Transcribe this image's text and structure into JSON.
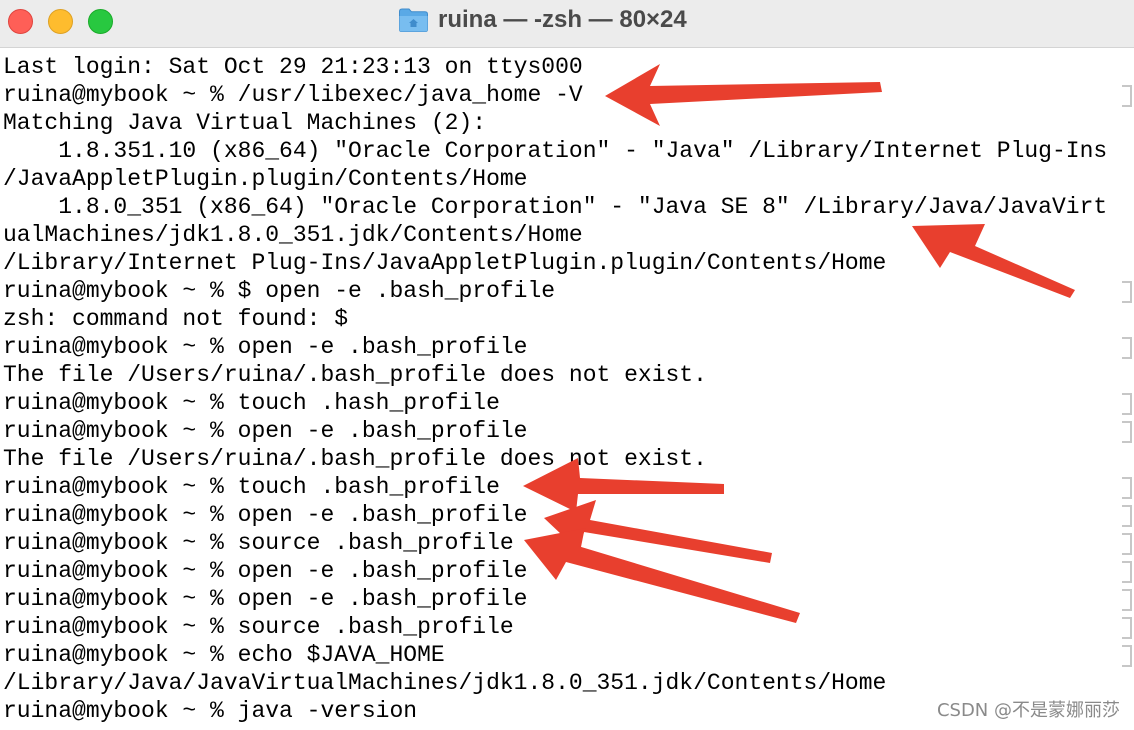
{
  "window": {
    "title": "ruina — -zsh — 80×24"
  },
  "icons": {
    "close": "close-light",
    "minimize": "minimize-light",
    "zoom": "zoom-light",
    "folder": "folder-icon"
  },
  "colors": {
    "close": "#fe5f57",
    "minimize": "#febc2e",
    "zoom": "#28c840",
    "titlebar": "#ececec",
    "arrow": "#e83f2e"
  },
  "terminal": {
    "lines": [
      "Last login: Sat Oct 29 21:23:13 on ttys000",
      "ruina@mybook ~ % /usr/libexec/java_home -V",
      "Matching Java Virtual Machines (2):",
      "    1.8.351.10 (x86_64) \"Oracle Corporation\" - \"Java\" /Library/Internet Plug-Ins",
      "/JavaAppletPlugin.plugin/Contents/Home",
      "    1.8.0_351 (x86_64) \"Oracle Corporation\" - \"Java SE 8\" /Library/Java/JavaVirt",
      "ualMachines/jdk1.8.0_351.jdk/Contents/Home",
      "/Library/Internet Plug-Ins/JavaAppletPlugin.plugin/Contents/Home",
      "ruina@mybook ~ % $ open -e .bash_profile",
      "zsh: command not found: $",
      "ruina@mybook ~ % open -e .bash_profile",
      "The file /Users/ruina/.bash_profile does not exist.",
      "ruina@mybook ~ % touch .hash_profile",
      "ruina@mybook ~ % open -e .bash_profile",
      "The file /Users/ruina/.bash_profile does not exist.",
      "ruina@mybook ~ % touch .bash_profile",
      "ruina@mybook ~ % open -e .bash_profile",
      "ruina@mybook ~ % source .bash_profile",
      "ruina@mybook ~ % open -e .bash_profile",
      "ruina@mybook ~ % open -e .bash_profile",
      "ruina@mybook ~ % source .bash_profile",
      "ruina@mybook ~ % echo $JAVA_HOME",
      "/Library/Java/JavaVirtualMachines/jdk1.8.0_351.jdk/Contents/Home",
      "ruina@mybook ~ % java -version"
    ]
  },
  "watermark": {
    "text": "CSDN @不是蒙娜丽莎"
  }
}
